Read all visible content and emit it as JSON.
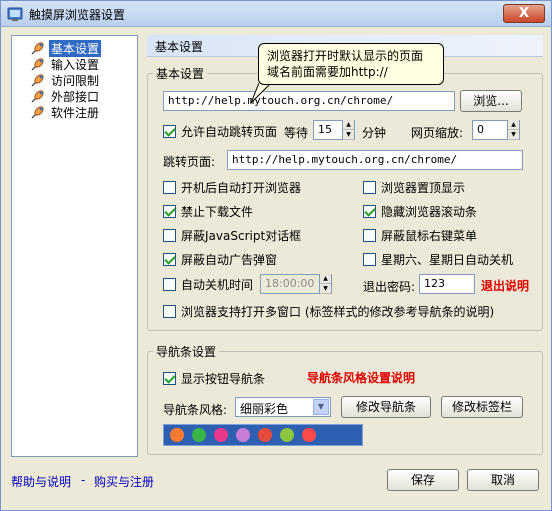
{
  "window": {
    "title": "触摸屏浏览器设置",
    "close_label": "X"
  },
  "tree": {
    "items": [
      {
        "label": "基本设置",
        "selected": true
      },
      {
        "label": "输入设置",
        "selected": false
      },
      {
        "label": "访问限制",
        "selected": false
      },
      {
        "label": "外部接口",
        "selected": false
      },
      {
        "label": "软件注册",
        "selected": false
      }
    ]
  },
  "panel": {
    "header": "基本设置",
    "tooltip": {
      "line1": "浏览器打开时默认显示的页面",
      "line2": "域名前面需要加http://"
    },
    "basic_group_title": "基本设置",
    "homepage_url": "http://help.mytouch.org.cn/chrome/",
    "browse_button": "浏览...",
    "auto_jump": {
      "label": "允许自动跳转页面",
      "checked": true,
      "wait_label": "等待",
      "wait_value": "15",
      "unit": "分钟"
    },
    "zoom": {
      "label": "网页缩放:",
      "value": "0"
    },
    "jump_page": {
      "label": "跳转页面:",
      "value": "http://help.mytouch.org.cn/chrome/"
    },
    "options_left": [
      {
        "label": "开机后自动打开浏览器",
        "checked": false
      },
      {
        "label": "禁止下载文件",
        "checked": true
      },
      {
        "label": "屏蔽JavaScript对话框",
        "checked": false
      },
      {
        "label": "屏蔽自动广告弹窗",
        "checked": true
      }
    ],
    "options_right": [
      {
        "label": "浏览器置顶显示",
        "checked": false
      },
      {
        "label": "隐藏浏览器滚动条",
        "checked": true
      },
      {
        "label": "屏蔽鼠标右键菜单",
        "checked": false
      },
      {
        "label": "星期六、星期日自动关机",
        "checked": false
      }
    ],
    "shutdown": {
      "label": "自动关机时间",
      "checked": false,
      "time": "18:00:00"
    },
    "exit_password": {
      "label": "退出密码:",
      "value": "123",
      "help": "退出说明"
    },
    "multi_window": {
      "label": "浏览器支持打开多窗口 (标签样式的修改参考导航条的说明)",
      "checked": false
    },
    "nav_group_title": "导航条设置",
    "show_nav": {
      "label": "显示按钮导航条",
      "checked": true
    },
    "nav_help": "导航条风格设置说明",
    "nav_style": {
      "label": "导航条风格:",
      "value": "细丽彩色"
    },
    "modify_nav_button": "修改导航条",
    "modify_tab_button": "修改标签栏",
    "nav_preview_colors": [
      "#ff7a2e",
      "#39b54a",
      "#e8398c",
      "#c77dd6",
      "#e84b3c",
      "#8cc63f",
      "#ff4a4a"
    ]
  },
  "footer": {
    "help_link": "帮助与说明",
    "separator": "-",
    "buy_link": "购买与注册",
    "save_button": "保存",
    "cancel_button": "取消"
  },
  "colors": {
    "accent": "#316ac5",
    "danger": "#e00000",
    "link": "#0000c0"
  }
}
